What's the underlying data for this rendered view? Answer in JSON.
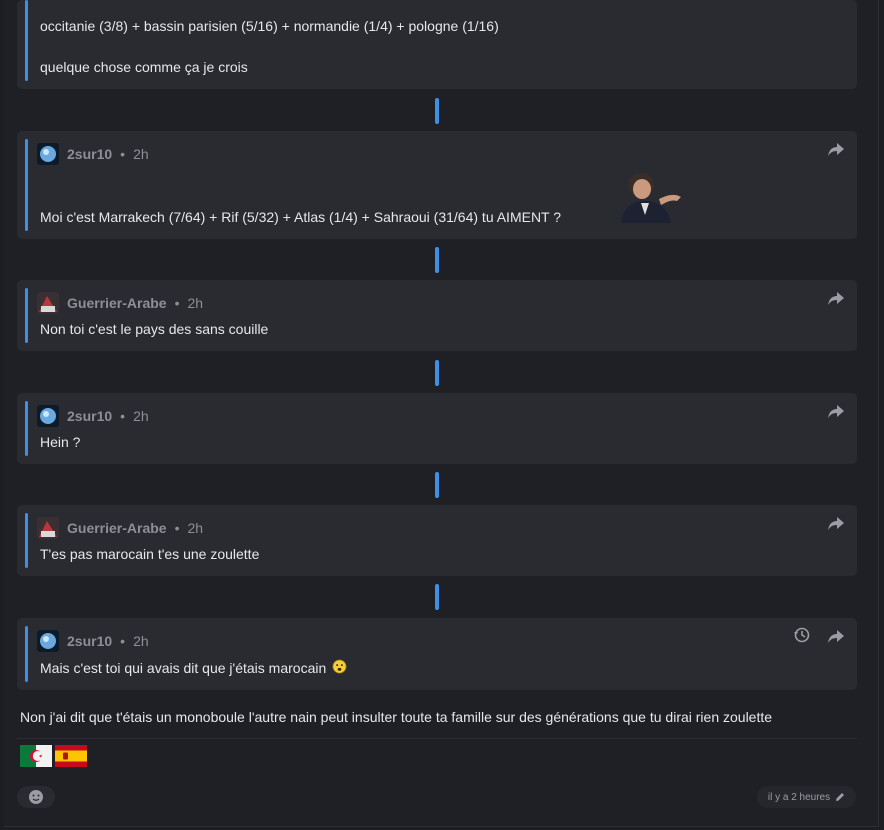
{
  "thread": {
    "first": {
      "lines": [
        "occitanie (3/8) + bassin parisien (5/16) + normandie (1/4) + pologne (1/16)",
        "quelque chose comme ça je crois"
      ]
    },
    "quotes": [
      {
        "author": "2sur10",
        "time": "2h",
        "text": "Moi c'est Marrakech (7/64) + Rif (5/32) + Atlas (1/4) + Sahraoui (31/64) tu AIMENT ?"
      },
      {
        "author": "Guerrier-Arabe",
        "time": "2h",
        "text": "Non toi c'est le pays des sans couille"
      },
      {
        "author": "2sur10",
        "time": "2h",
        "text": "Hein ?"
      },
      {
        "author": "Guerrier-Arabe",
        "time": "2h",
        "text": "T'es pas marocain t'es une zoulette"
      },
      {
        "author": "2sur10",
        "time": "2h",
        "text": "Mais c'est toi qui avais dit que j'étais marocain"
      }
    ],
    "separator": "•"
  },
  "reply": {
    "text": "Non j'ai dit que t'étais un monoboule l'autre nain peut insulter toute ta famille sur des générations que tu dirai rien zoulette",
    "timestamp": "il y a 2 heures"
  },
  "flags": [
    "algeria-flag",
    "spain-flag"
  ],
  "colors": {
    "accent": "#3f8fe6",
    "card": "#2a2b31",
    "background": "#1f2025"
  }
}
